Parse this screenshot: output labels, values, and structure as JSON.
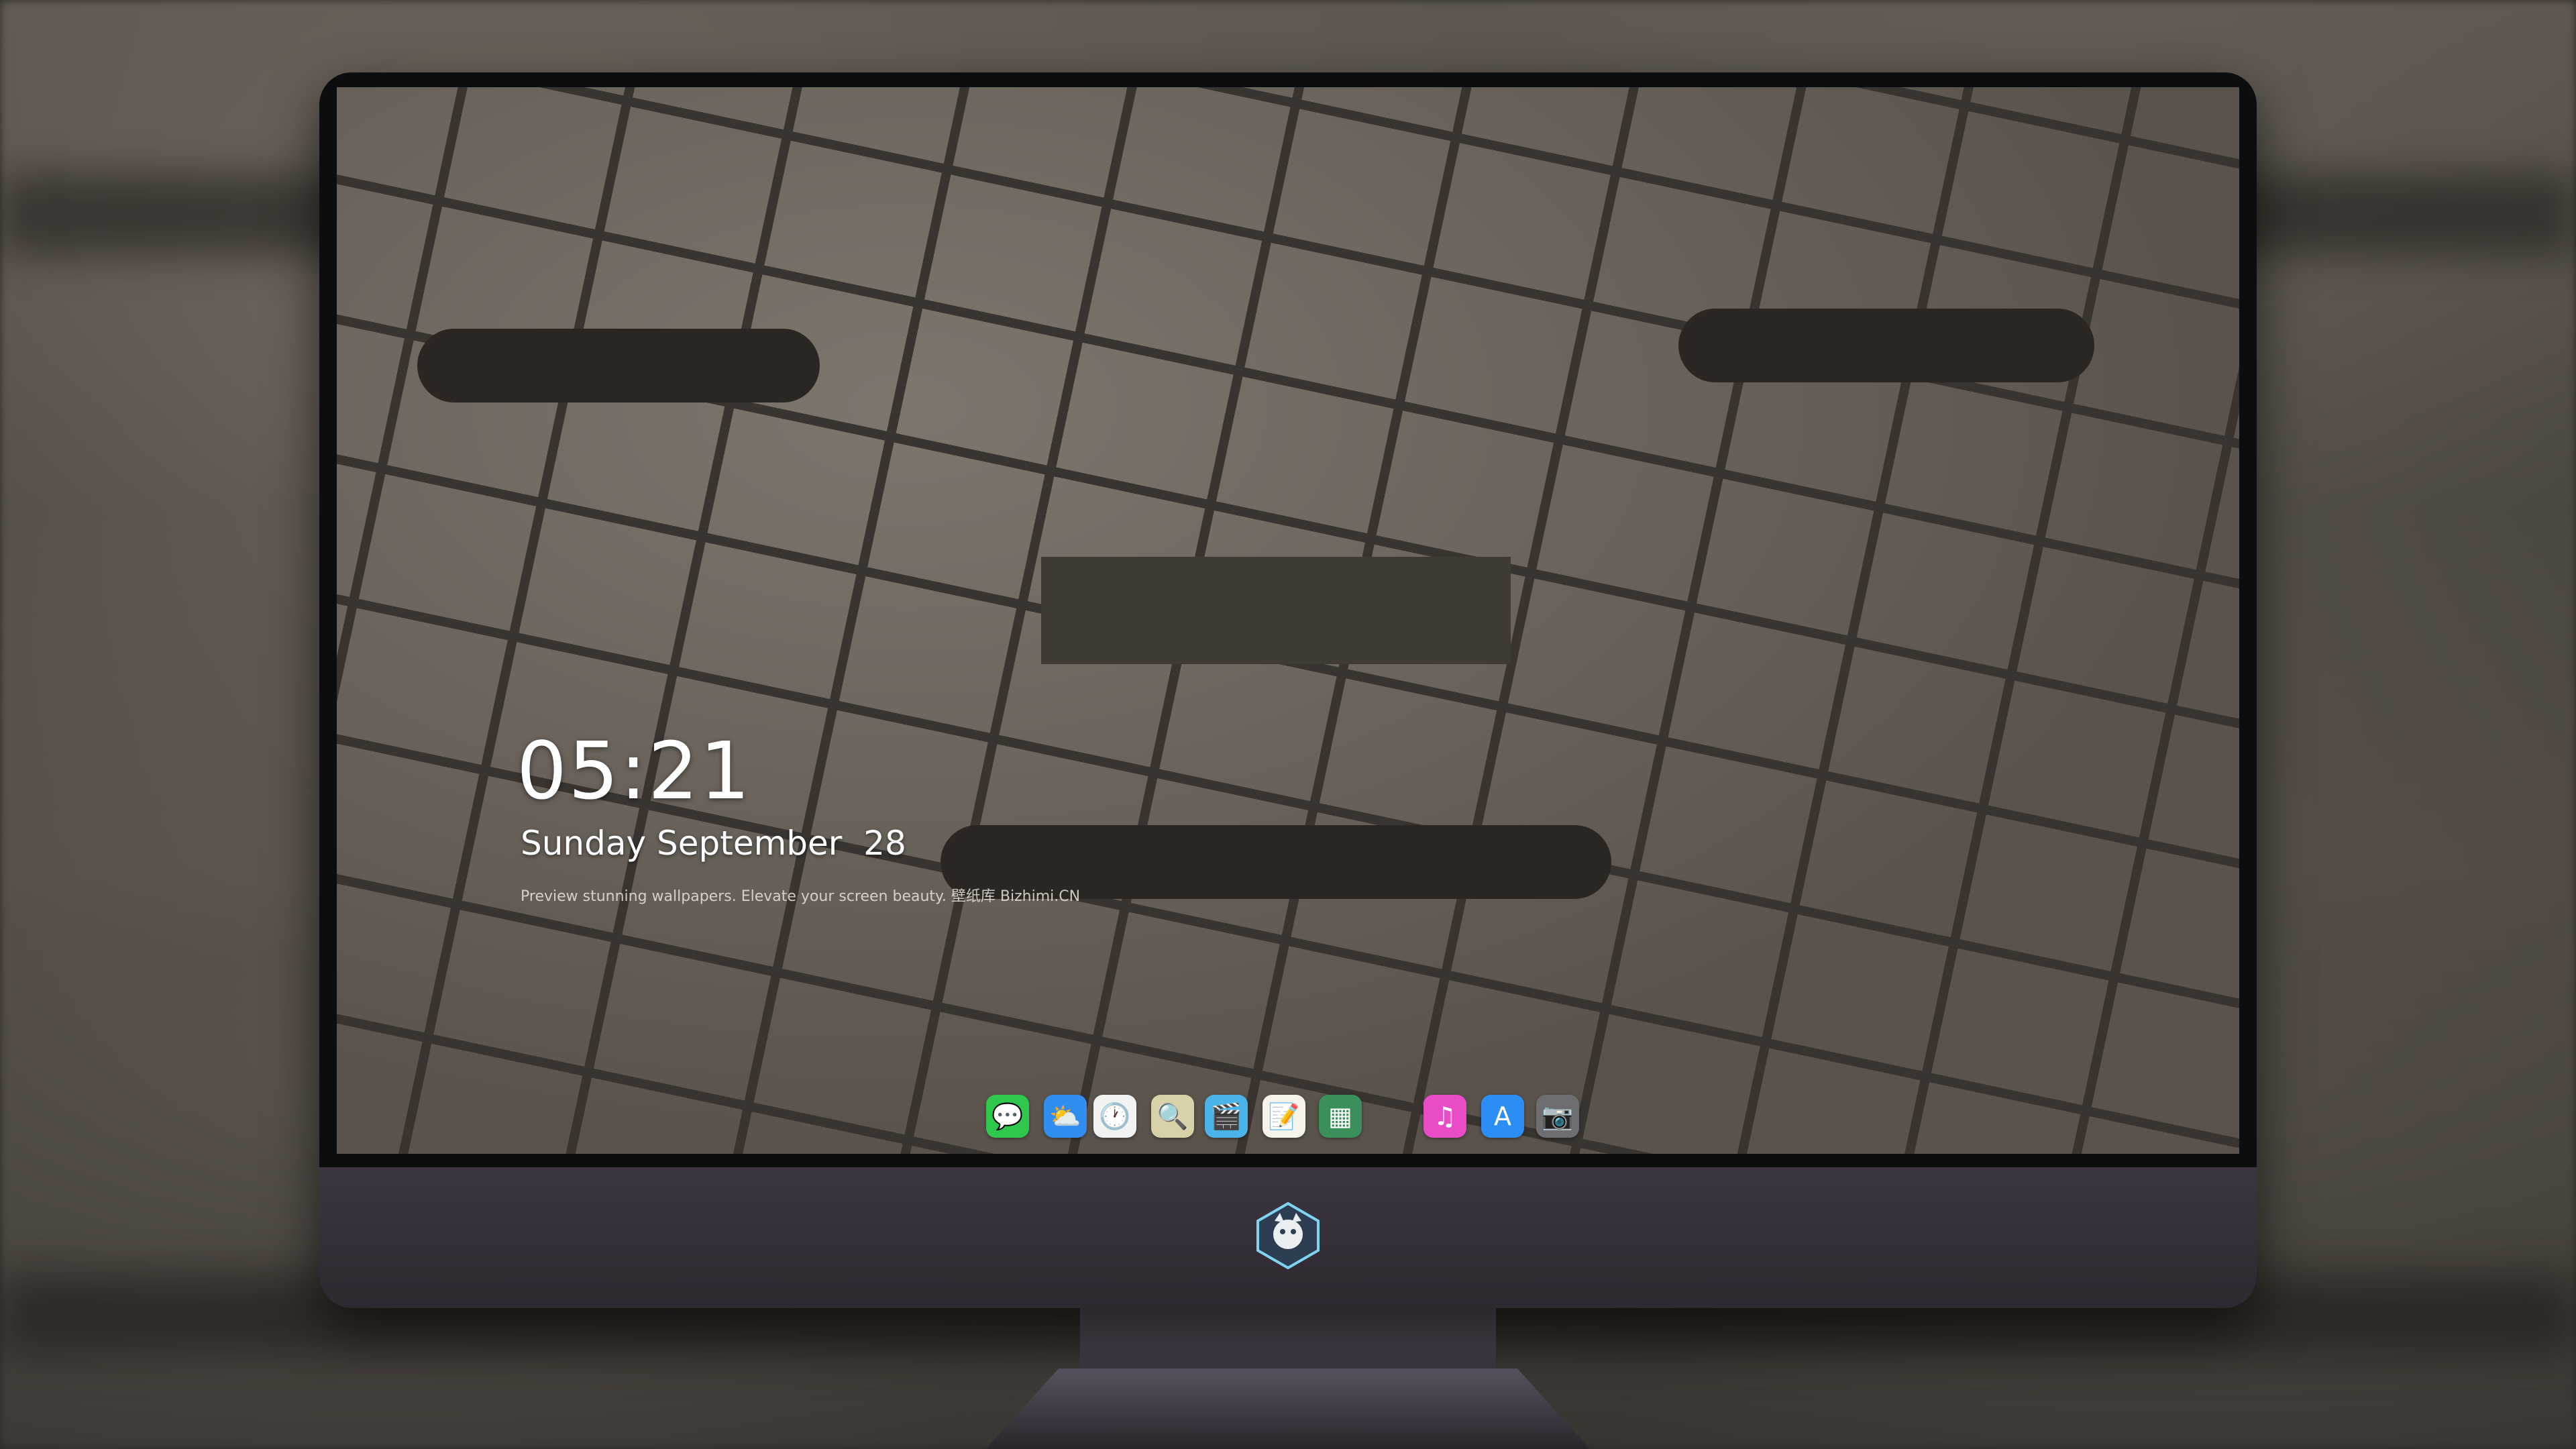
{
  "lock_screen": {
    "time": "05:21",
    "date": "Sunday September  28",
    "tagline": "Preview stunning wallpapers. Elevate your screen beauty. 壁纸库 Bizhimi.CN"
  },
  "dock": {
    "apps": [
      {
        "name": "messages-icon",
        "glyph": "💬",
        "color": "#2fc84c"
      },
      {
        "name": "weather-icon",
        "glyph": "⛅",
        "color": "#2f8ef0"
      },
      {
        "name": "clock-icon",
        "glyph": "🕐",
        "color": "#f2f2f2"
      },
      {
        "name": "preview-icon",
        "glyph": "🔍",
        "color": "#d9d2a8"
      },
      {
        "name": "clips-icon",
        "glyph": "🎬",
        "color": "#4ab4e8"
      },
      {
        "name": "notes-icon",
        "glyph": "📝",
        "color": "#f6f3e8"
      },
      {
        "name": "photo-booth-icon",
        "glyph": "▦",
        "color": "#3a8f5a"
      },
      {
        "name": "music-icon",
        "glyph": "♫",
        "color": "#e94cc6"
      },
      {
        "name": "app-store-icon",
        "glyph": "A",
        "color": "#2b8ef5"
      },
      {
        "name": "camera-icon",
        "glyph": "📷",
        "color": "#6e6e72"
      }
    ]
  },
  "colors": {
    "monitor_bezel": "#0d0c0e",
    "monitor_chin": "#3d3640",
    "text": "#ffffff"
  }
}
